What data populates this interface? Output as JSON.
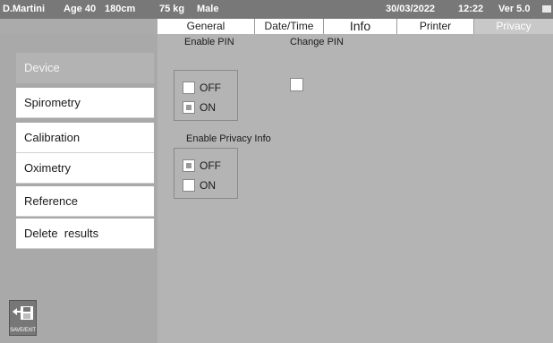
{
  "status": {
    "patient": "D.Martini",
    "age": "Age 40",
    "height": "180cm",
    "weight": "75 kg",
    "sex": "Male",
    "date": "30/03/2022",
    "time": "12:22",
    "version": "Ver 5.0",
    "battery_icon": "battery-icon"
  },
  "tabs": [
    {
      "label": "General"
    },
    {
      "label": "Date/Time"
    },
    {
      "label": "Info"
    },
    {
      "label": "Printer"
    },
    {
      "label": "Privacy"
    }
  ],
  "sidebar": {
    "items": [
      {
        "label": "Device"
      },
      {
        "label": "Spirometry"
      },
      {
        "label": "Calibration"
      },
      {
        "label": "Oximetry"
      },
      {
        "label": "Reference"
      },
      {
        "label": "Delete  results"
      }
    ]
  },
  "save_exit": {
    "label": "SAVE/EXIT",
    "icon": "save-exit-icon"
  },
  "privacy": {
    "enable_pin": {
      "title": "Enable PIN",
      "off": "OFF",
      "on": "ON",
      "selected": "ON"
    },
    "change_pin": {
      "title": "Change PIN"
    },
    "enable_privacy_info": {
      "title": "Enable Privacy Info",
      "off": "OFF",
      "on": "ON",
      "selected": "OFF"
    }
  },
  "colors": {
    "status_bar": "#787878",
    "background": "#b4b4b4",
    "active_tab": "#c8c8c8",
    "active_sidebar": "#b3b3b3"
  }
}
